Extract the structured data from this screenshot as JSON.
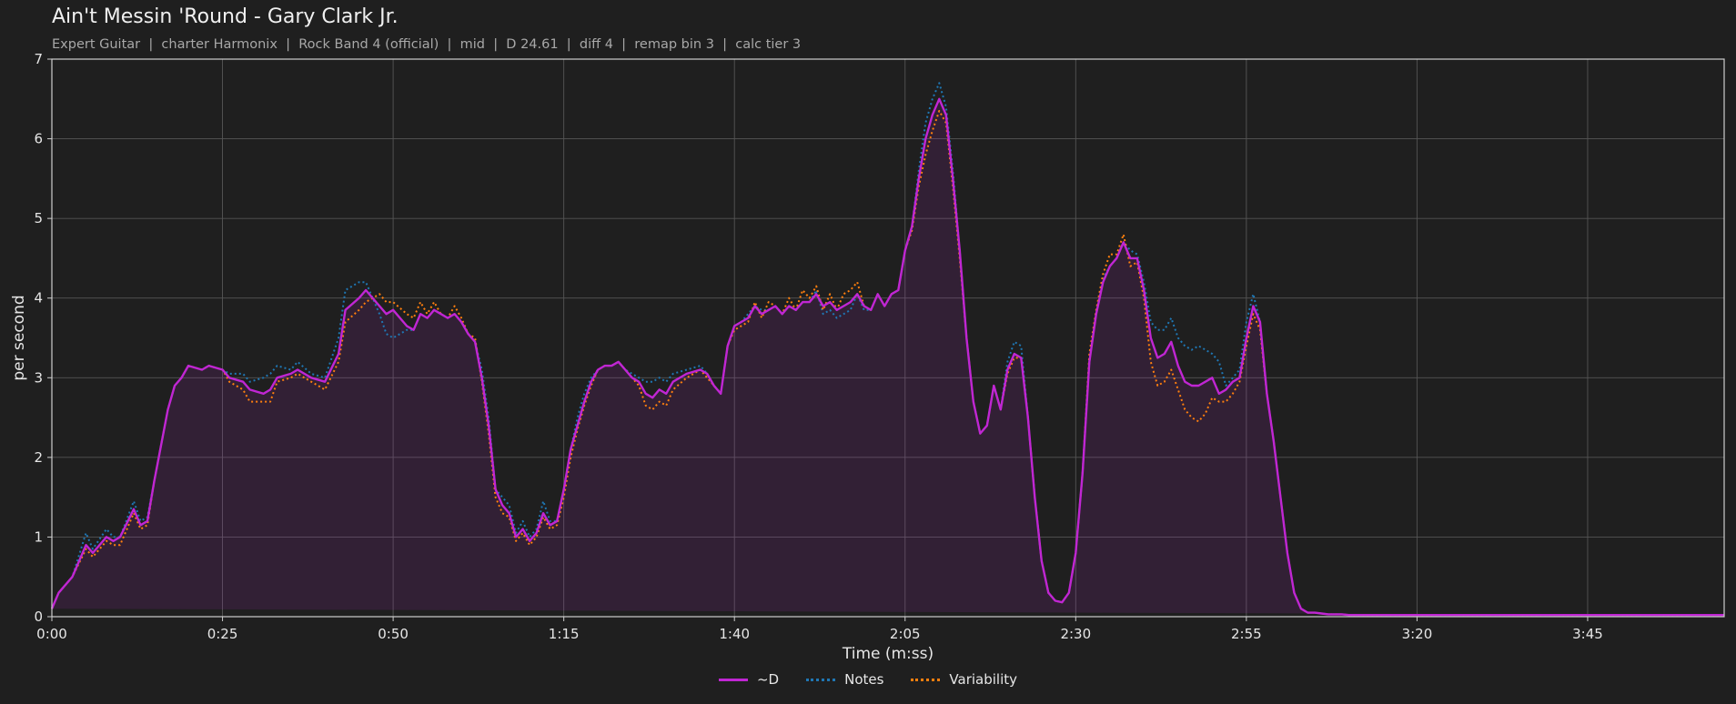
{
  "header": {
    "title": "Ain't Messin 'Round - Gary Clark Jr.",
    "subtitle": "Expert Guitar  |  charter Harmonix  |  Rock Band 4 (official)  |  mid  |  D 24.61  |  diff 4  |  remap bin 3  |  calc tier 3"
  },
  "colors": {
    "background": "#1f1f1f",
    "d": "#c026d3",
    "notes": "#1f77b4",
    "variability": "#ff7f0e"
  },
  "chart_data": {
    "type": "line",
    "title": "Ain't Messin 'Round - Gary Clark Jr.",
    "subtitle": "Expert Guitar  |  charter Harmonix  |  Rock Band 4 (official)  |  mid  |  D 24.61  |  diff 4  |  remap bin 3  |  calc tier 3",
    "xlabel": "Time (m:ss)",
    "ylabel": "per second",
    "xlim": [
      "0:00",
      "4:05"
    ],
    "ylim": [
      0,
      7
    ],
    "xticks": [
      "0:00",
      "0:25",
      "0:50",
      "1:15",
      "1:40",
      "2:05",
      "2:30",
      "2:55",
      "3:20",
      "3:45"
    ],
    "yticks": [
      0,
      1,
      2,
      3,
      4,
      5,
      6,
      7
    ],
    "grid": true,
    "legend_position": "bottom-center",
    "x": [
      "0:00",
      "0:01",
      "0:03",
      "0:05",
      "0:06",
      "0:08",
      "0:09",
      "0:10",
      "0:12",
      "0:13",
      "0:14",
      "0:15",
      "0:17",
      "0:18",
      "0:19",
      "0:20",
      "0:22",
      "0:23",
      "0:25",
      "0:26",
      "0:28",
      "0:29",
      "0:31",
      "0:32",
      "0:33",
      "0:35",
      "0:36",
      "0:38",
      "0:40",
      "0:42",
      "0:43",
      "0:45",
      "0:46",
      "0:48",
      "0:49",
      "0:50",
      "0:52",
      "0:53",
      "0:54",
      "0:55",
      "0:56",
      "0:57",
      "0:58",
      "0:59",
      "1:00",
      "1:01",
      "1:02",
      "1:03",
      "1:04",
      "1:05",
      "1:06",
      "1:07",
      "1:08",
      "1:09",
      "1:10",
      "1:11",
      "1:12",
      "1:13",
      "1:14",
      "1:15",
      "1:16",
      "1:17",
      "1:18",
      "1:19",
      "1:20",
      "1:21",
      "1:22",
      "1:23",
      "1:24",
      "1:25",
      "1:26",
      "1:27",
      "1:28",
      "1:29",
      "1:30",
      "1:31",
      "1:33",
      "1:35",
      "1:36",
      "1:37",
      "1:38",
      "1:39",
      "1:40",
      "1:41",
      "1:42",
      "1:43",
      "1:44",
      "1:45",
      "1:46",
      "1:47",
      "1:48",
      "1:49",
      "1:50",
      "1:51",
      "1:52",
      "1:53",
      "1:54",
      "1:55",
      "1:56",
      "1:57",
      "1:58",
      "1:59",
      "2:00",
      "2:01",
      "2:02",
      "2:03",
      "2:04",
      "2:05",
      "2:06",
      "2:07",
      "2:08",
      "2:09",
      "2:10",
      "2:11",
      "2:12",
      "2:13",
      "2:14",
      "2:15",
      "2:16",
      "2:17",
      "2:18",
      "2:19",
      "2:20",
      "2:21",
      "2:22",
      "2:23",
      "2:24",
      "2:25",
      "2:26",
      "2:27",
      "2:28",
      "2:29",
      "2:30",
      "2:31",
      "2:32",
      "2:33",
      "2:34",
      "2:35",
      "2:36",
      "2:37",
      "2:38",
      "2:39",
      "2:40",
      "2:41",
      "2:42",
      "2:43",
      "2:44",
      "2:45",
      "2:46",
      "2:47",
      "2:48",
      "2:49",
      "2:50",
      "2:51",
      "2:52",
      "2:53",
      "2:54",
      "2:55",
      "2:56",
      "2:57",
      "2:58",
      "2:59",
      "3:00",
      "3:01",
      "3:02",
      "3:03",
      "3:04",
      "3:05",
      "3:06",
      "3:07",
      "3:08",
      "3:09",
      "3:10",
      "3:11",
      "3:12",
      "3:13",
      "3:14",
      "3:15",
      "3:16",
      "3:17",
      "3:18",
      "3:19",
      "3:20",
      "3:21",
      "3:22",
      "3:23",
      "3:24",
      "3:25",
      "3:26",
      "3:27",
      "3:28",
      "3:29",
      "3:30",
      "3:31",
      "3:32",
      "3:33",
      "3:34",
      "3:35",
      "3:36",
      "3:37",
      "3:38",
      "3:39",
      "3:40",
      "3:41",
      "3:42",
      "3:43",
      "3:44",
      "3:45",
      "3:46",
      "3:47",
      "3:48",
      "3:49",
      "3:50",
      "3:51",
      "3:52",
      "3:53",
      "3:54",
      "3:55",
      "3:56",
      "3:57",
      "3:58",
      "3:59",
      "4:00",
      "4:01",
      "4:02",
      "4:03",
      "4:04",
      "4:05"
    ],
    "series": [
      {
        "name": "~D",
        "color": "#c026d3",
        "style": "solid",
        "values": [
          0.1,
          0.3,
          0.5,
          0.9,
          0.8,
          1.0,
          0.95,
          1.0,
          1.35,
          1.15,
          1.2,
          1.7,
          2.6,
          2.9,
          3.0,
          3.15,
          3.1,
          3.15,
          3.1,
          3.0,
          2.95,
          2.85,
          2.8,
          2.85,
          3.0,
          3.05,
          3.1,
          3.0,
          2.95,
          3.3,
          3.85,
          4.0,
          4.1,
          3.9,
          3.8,
          3.85,
          3.65,
          3.6,
          3.8,
          3.75,
          3.85,
          3.8,
          3.75,
          3.8,
          3.7,
          3.55,
          3.45,
          3.0,
          2.4,
          1.6,
          1.4,
          1.3,
          1.0,
          1.1,
          0.95,
          1.05,
          1.3,
          1.15,
          1.2,
          1.6,
          2.1,
          2.4,
          2.7,
          2.95,
          3.1,
          3.15,
          3.15,
          3.2,
          3.1,
          3.0,
          2.95,
          2.8,
          2.75,
          2.85,
          2.8,
          2.95,
          3.05,
          3.1,
          3.05,
          2.9,
          2.8,
          3.4,
          3.65,
          3.7,
          3.75,
          3.9,
          3.8,
          3.85,
          3.9,
          3.8,
          3.9,
          3.85,
          3.95,
          3.95,
          4.05,
          3.9,
          3.95,
          3.85,
          3.9,
          3.95,
          4.05,
          3.9,
          3.85,
          4.05,
          3.9,
          4.05,
          4.1,
          4.6,
          4.9,
          5.5,
          6.0,
          6.3,
          6.5,
          6.3,
          5.5,
          4.6,
          3.5,
          2.7,
          2.3,
          2.4,
          2.9,
          2.6,
          3.1,
          3.3,
          3.25,
          2.5,
          1.5,
          0.7,
          0.3,
          0.2,
          0.18,
          0.3,
          0.8,
          1.8,
          3.2,
          3.8,
          4.2,
          4.4,
          4.5,
          4.7,
          4.5,
          4.5,
          4.1,
          3.5,
          3.25,
          3.3,
          3.45,
          3.15,
          2.95,
          2.9,
          2.9,
          2.95,
          3.0,
          2.8,
          2.85,
          2.95,
          3.0,
          3.5,
          3.9,
          3.7,
          2.8,
          2.2,
          1.5,
          0.8,
          0.3,
          0.1,
          0.05,
          0.05,
          0.04,
          0.03,
          0.03,
          0.03,
          0.02,
          0.02,
          0.02,
          0.02,
          0.02,
          0.02,
          0.02,
          0.02,
          0.02,
          0.02,
          0.02,
          0.02,
          0.02,
          0.02,
          0.02,
          0.02,
          0.02,
          0.02,
          0.02,
          0.02,
          0.02,
          0.02,
          0.02,
          0.02,
          0.02,
          0.02,
          0.02,
          0.02,
          0.02,
          0.02,
          0.02,
          0.02,
          0.02,
          0.02,
          0.02,
          0.02,
          0.02,
          0.02,
          0.02,
          0.02,
          0.02,
          0.02,
          0.02,
          0.02,
          0.02,
          0.02,
          0.02,
          0.02,
          0.02,
          0.02,
          0.02,
          0.02,
          0.02,
          0.02,
          0.02,
          0.02,
          0.02,
          0.02,
          0.02,
          0.02,
          0.02,
          0.02,
          0.02,
          0.02,
          0.02,
          0.02,
          0.02
        ]
      },
      {
        "name": "Notes",
        "color": "#1f77b4",
        "style": "dotted",
        "values": [
          0.1,
          0.3,
          0.5,
          1.05,
          0.85,
          1.1,
          1.0,
          1.0,
          1.45,
          1.2,
          1.25,
          1.7,
          2.6,
          2.9,
          3.0,
          3.15,
          3.1,
          3.15,
          3.1,
          3.05,
          3.05,
          2.95,
          3.0,
          3.05,
          3.15,
          3.1,
          3.2,
          3.05,
          3.0,
          3.5,
          4.1,
          4.2,
          4.2,
          3.8,
          3.55,
          3.5,
          3.6,
          3.6,
          3.8,
          3.75,
          3.85,
          3.8,
          3.75,
          3.8,
          3.7,
          3.55,
          3.45,
          3.1,
          2.5,
          1.6,
          1.5,
          1.4,
          1.05,
          1.2,
          1.0,
          1.1,
          1.45,
          1.2,
          1.2,
          1.6,
          2.1,
          2.5,
          2.8,
          3.0,
          3.1,
          3.15,
          3.15,
          3.2,
          3.1,
          3.05,
          3.0,
          2.95,
          2.95,
          3.0,
          2.95,
          3.05,
          3.1,
          3.15,
          3.05,
          2.9,
          2.8,
          3.4,
          3.65,
          3.7,
          3.8,
          3.9,
          3.85,
          3.85,
          3.9,
          3.8,
          3.9,
          3.85,
          3.95,
          3.95,
          4.1,
          3.8,
          3.85,
          3.75,
          3.8,
          3.85,
          4.05,
          3.85,
          3.85,
          4.05,
          3.9,
          4.05,
          4.1,
          4.6,
          4.9,
          5.6,
          6.2,
          6.5,
          6.7,
          6.4,
          5.6,
          4.6,
          3.5,
          2.7,
          2.3,
          2.4,
          2.9,
          2.6,
          3.2,
          3.45,
          3.4,
          2.5,
          1.5,
          0.7,
          0.3,
          0.2,
          0.18,
          0.3,
          0.8,
          1.8,
          3.2,
          3.8,
          4.25,
          4.4,
          4.5,
          4.7,
          4.6,
          4.55,
          4.2,
          3.7,
          3.6,
          3.6,
          3.75,
          3.5,
          3.4,
          3.35,
          3.4,
          3.35,
          3.3,
          3.2,
          2.9,
          3.0,
          3.1,
          3.7,
          4.05,
          3.7,
          2.8,
          2.2,
          1.5,
          0.8,
          0.3,
          0.1,
          0.05,
          0.05,
          0.04,
          0.03,
          0.03,
          0.03,
          0.02,
          0.02,
          0.02,
          0.02,
          0.02,
          0.02,
          0.02,
          0.02,
          0.02,
          0.02,
          0.02,
          0.02,
          0.02,
          0.02,
          0.02,
          0.02,
          0.02,
          0.02,
          0.02,
          0.02,
          0.02,
          0.02,
          0.02,
          0.02,
          0.02,
          0.02,
          0.02,
          0.02,
          0.02,
          0.02,
          0.02,
          0.02,
          0.02,
          0.02,
          0.02,
          0.02,
          0.02,
          0.02,
          0.02,
          0.02,
          0.02,
          0.02,
          0.02,
          0.02,
          0.02,
          0.02,
          0.02,
          0.02,
          0.02,
          0.02,
          0.02,
          0.02,
          0.02,
          0.02,
          0.02,
          0.02,
          0.02,
          0.02,
          0.02,
          0.02,
          0.02,
          0.02,
          0.02,
          0.02,
          0.02,
          0.02,
          0.02
        ]
      },
      {
        "name": "Variability",
        "color": "#ff7f0e",
        "style": "dotted",
        "values": [
          0.1,
          0.3,
          0.5,
          0.85,
          0.75,
          0.95,
          0.9,
          0.9,
          1.3,
          1.1,
          1.15,
          1.7,
          2.6,
          2.9,
          3.0,
          3.15,
          3.1,
          3.15,
          3.1,
          2.95,
          2.85,
          2.7,
          2.7,
          2.7,
          2.95,
          3.0,
          3.05,
          2.95,
          2.85,
          3.2,
          3.7,
          3.85,
          3.95,
          4.05,
          3.95,
          3.95,
          3.8,
          3.75,
          3.95,
          3.8,
          3.95,
          3.8,
          3.75,
          3.9,
          3.75,
          3.55,
          3.5,
          2.95,
          2.3,
          1.5,
          1.3,
          1.25,
          0.95,
          1.05,
          0.9,
          1.0,
          1.25,
          1.1,
          1.15,
          1.5,
          2.0,
          2.35,
          2.65,
          2.9,
          3.1,
          3.15,
          3.15,
          3.2,
          3.1,
          3.0,
          2.9,
          2.65,
          2.6,
          2.7,
          2.65,
          2.85,
          3.0,
          3.1,
          3.0,
          2.9,
          2.8,
          3.4,
          3.6,
          3.65,
          3.7,
          3.95,
          3.75,
          3.95,
          3.9,
          3.8,
          4.0,
          3.85,
          4.1,
          4.0,
          4.15,
          3.85,
          4.05,
          3.85,
          4.05,
          4.1,
          4.2,
          3.9,
          3.85,
          4.05,
          3.9,
          4.05,
          4.1,
          4.6,
          4.85,
          5.4,
          5.8,
          6.1,
          6.35,
          6.2,
          5.4,
          4.5,
          3.5,
          2.7,
          2.3,
          2.4,
          2.9,
          2.6,
          3.05,
          3.25,
          3.25,
          2.5,
          1.5,
          0.7,
          0.3,
          0.2,
          0.18,
          0.3,
          0.8,
          1.8,
          3.3,
          3.85,
          4.3,
          4.55,
          4.55,
          4.8,
          4.4,
          4.45,
          4.0,
          3.2,
          2.9,
          2.95,
          3.1,
          2.85,
          2.6,
          2.5,
          2.45,
          2.55,
          2.75,
          2.7,
          2.7,
          2.8,
          2.95,
          3.4,
          3.8,
          3.6,
          2.8,
          2.2,
          1.5,
          0.8,
          0.3,
          0.1,
          0.05,
          0.05,
          0.04,
          0.03,
          0.03,
          0.03,
          0.02,
          0.02,
          0.02,
          0.02,
          0.02,
          0.02,
          0.02,
          0.02,
          0.02,
          0.02,
          0.02,
          0.02,
          0.02,
          0.02,
          0.02,
          0.02,
          0.02,
          0.02,
          0.02,
          0.02,
          0.02,
          0.02,
          0.02,
          0.02,
          0.02,
          0.02,
          0.02,
          0.02,
          0.02,
          0.02,
          0.02,
          0.02,
          0.02,
          0.02,
          0.02,
          0.02,
          0.02,
          0.02,
          0.02,
          0.02,
          0.02,
          0.02,
          0.02,
          0.02,
          0.02,
          0.02,
          0.02,
          0.02,
          0.02,
          0.02,
          0.02,
          0.02,
          0.02,
          0.02,
          0.02,
          0.02,
          0.02,
          0.02,
          0.02,
          0.02,
          0.02,
          0.02,
          0.02,
          0.02,
          0.02,
          0.02,
          0.02
        ]
      }
    ]
  }
}
